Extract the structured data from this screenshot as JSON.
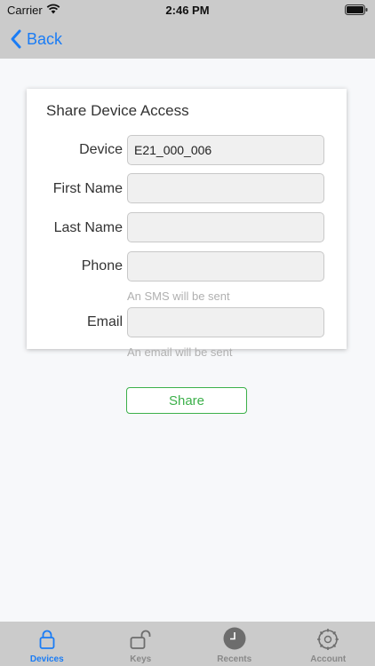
{
  "status": {
    "carrier": "Carrier",
    "time": "2:46 PM"
  },
  "nav": {
    "back_label": "Back"
  },
  "form": {
    "title": "Share Device Access",
    "device_label": "Device",
    "device_value": "E21_000_006",
    "first_name_label": "First Name",
    "first_name_value": "",
    "last_name_label": "Last Name",
    "last_name_value": "",
    "phone_label": "Phone",
    "phone_value": "",
    "phone_hint": "An SMS will be sent",
    "email_label": "Email",
    "email_value": "",
    "email_hint": "An email will be sent"
  },
  "actions": {
    "share_label": "Share"
  },
  "tabs": [
    {
      "label": "Devices",
      "icon": "lock-icon",
      "active": true
    },
    {
      "label": "Keys",
      "icon": "unlock-icon",
      "active": false
    },
    {
      "label": "Recents",
      "icon": "clock-icon",
      "active": false
    },
    {
      "label": "Account",
      "icon": "gear-icon",
      "active": false
    }
  ],
  "colors": {
    "accent": "#1a7cf5",
    "share": "#3cb04a",
    "bar": "#cbcbcb"
  }
}
